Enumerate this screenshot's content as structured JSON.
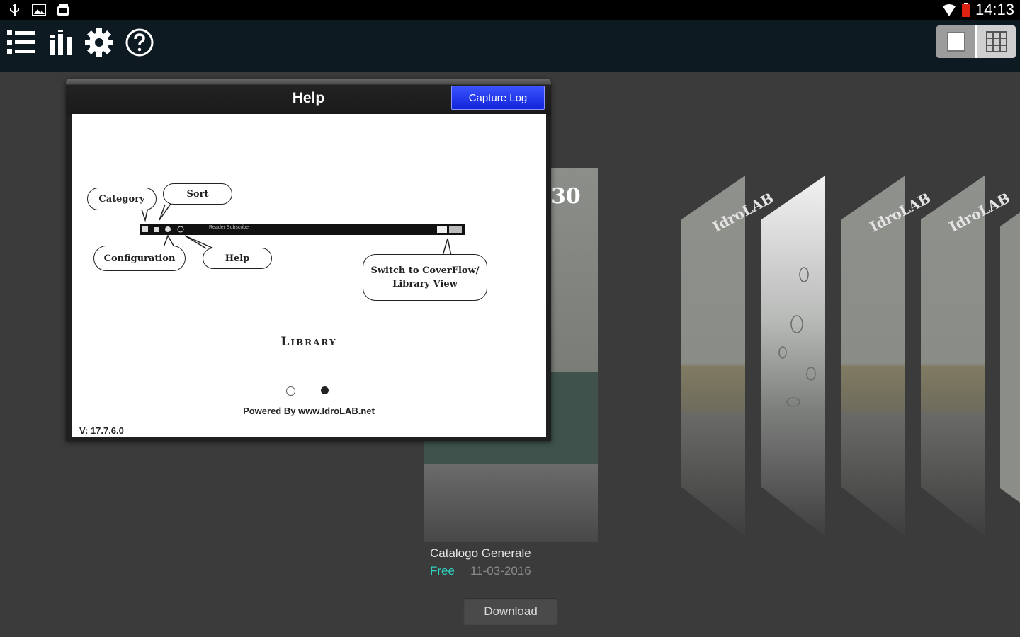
{
  "status_bar": {
    "time": "14:13",
    "left_icons": [
      "usb-icon",
      "image-icon",
      "screenshot-icon"
    ],
    "right_icons": [
      "wifi-icon",
      "battery-icon"
    ]
  },
  "toolbar": {
    "buttons": [
      "category-list-icon",
      "sort-icon",
      "settings-gear-icon",
      "help-icon"
    ],
    "view_switch": [
      "coverflow-view-icon",
      "grid-view-icon"
    ]
  },
  "help_dialog": {
    "title": "Help",
    "capture_button": "Capture Log",
    "callouts": {
      "category": "Category",
      "sort": "Sort",
      "configuration": "Configuration",
      "help": "Help",
      "switch_line1": "Switch to CoverFlow/",
      "switch_line2": "Library View"
    },
    "minibar_text": "Reader  Subscribe",
    "library": "Library",
    "powered_by": "Powered By www.IdroLAB.net",
    "version": "V: 17.7.6.0",
    "page_indicator": {
      "pages": 2,
      "current": 2
    }
  },
  "cover": {
    "logo_fragment": "30",
    "side_logo": "IdroLAB",
    "title": "Catalogo Generale",
    "price": "Free",
    "date": "11-03-2016",
    "download_button": "Download"
  },
  "colors": {
    "background": "#3b3b3b",
    "toolbar": "#0d1a22",
    "capture_button": "#1a2ef0",
    "price": "#2fd3c1"
  }
}
